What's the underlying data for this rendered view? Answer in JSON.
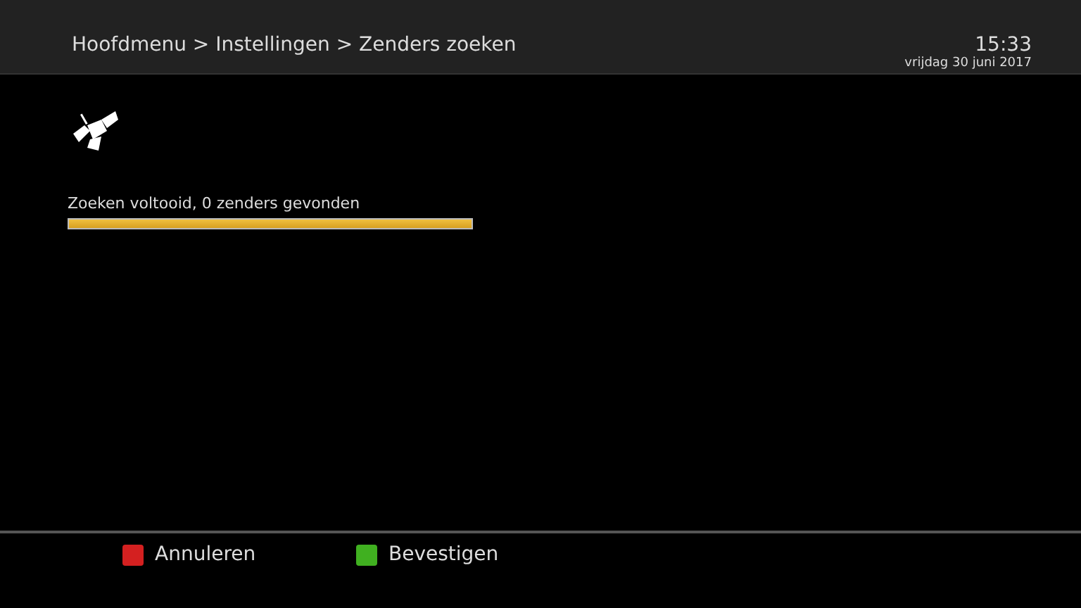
{
  "header": {
    "breadcrumb": "Hoofdmenu > Instellingen > Zenders zoeken",
    "time": "15:33",
    "date": "vrijdag 30 juni 2017"
  },
  "scan": {
    "status": "Zoeken voltooid, 0 zenders gevonden",
    "level": 1
  },
  "buttons": [
    {
      "label": "Annuleren",
      "color": "#d42020"
    },
    {
      "label": "Bevestigen",
      "color": "#40b020"
    }
  ]
}
